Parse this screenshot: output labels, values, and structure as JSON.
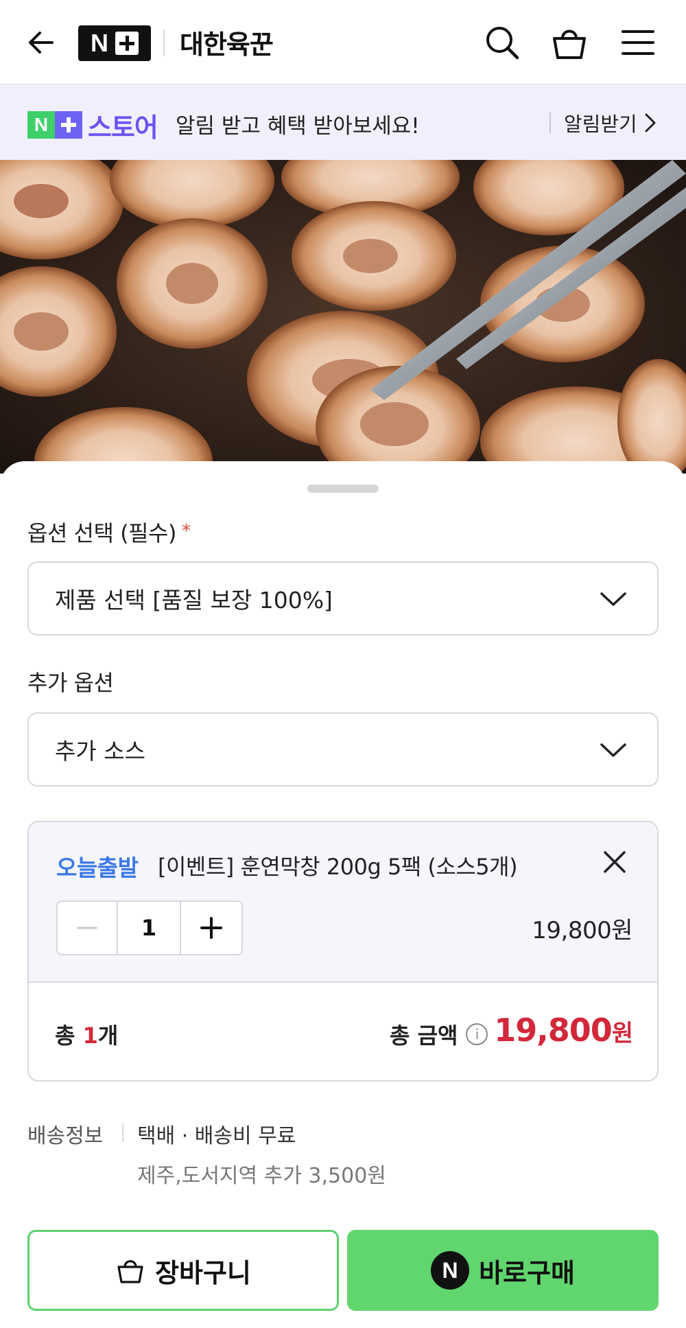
{
  "header": {
    "logo_letter": "N",
    "brand": "대한육꾼",
    "icons": [
      "back-arrow-icon",
      "search-icon",
      "shopping-bag-icon",
      "hamburger-menu-icon"
    ]
  },
  "notice": {
    "store_logo_letter": "N",
    "store_logo_text": "스토어",
    "message": "알림 받고 혜택 받아보세요!",
    "action_label": "알림받기"
  },
  "options": {
    "required_label": "옵션 선택 (필수)",
    "required_mark": "*",
    "required_selected": "제품 선택 [품질 보장 100%]",
    "extra_label": "추가 옵션",
    "extra_selected": "추가 소스"
  },
  "cart": {
    "badge": "오늘출발",
    "product_name": "[이벤트] 훈연막창 200g 5팩 (소스5개)",
    "quantity": "1",
    "unit_price": "19,800원",
    "total_prefix": "총 ",
    "total_count": "1",
    "total_suffix": "개",
    "total_label": "총 금액",
    "info_glyph": "i",
    "total_amount": "19,800",
    "total_currency": "원"
  },
  "delivery": {
    "label": "배송정보",
    "value": "택배 · 배송비 무료",
    "sub": "제주,도서지역 추가 3,500원"
  },
  "buttons": {
    "cart_label": "장바구니",
    "buy_label": "바로구매",
    "pay_logo_letter": "N"
  },
  "colors": {
    "accent_green": "#61d56e",
    "store_purple": "#6c52f0",
    "price_red": "#d2283a",
    "badge_blue": "#3a78e6",
    "notice_bg": "#f1effb"
  }
}
